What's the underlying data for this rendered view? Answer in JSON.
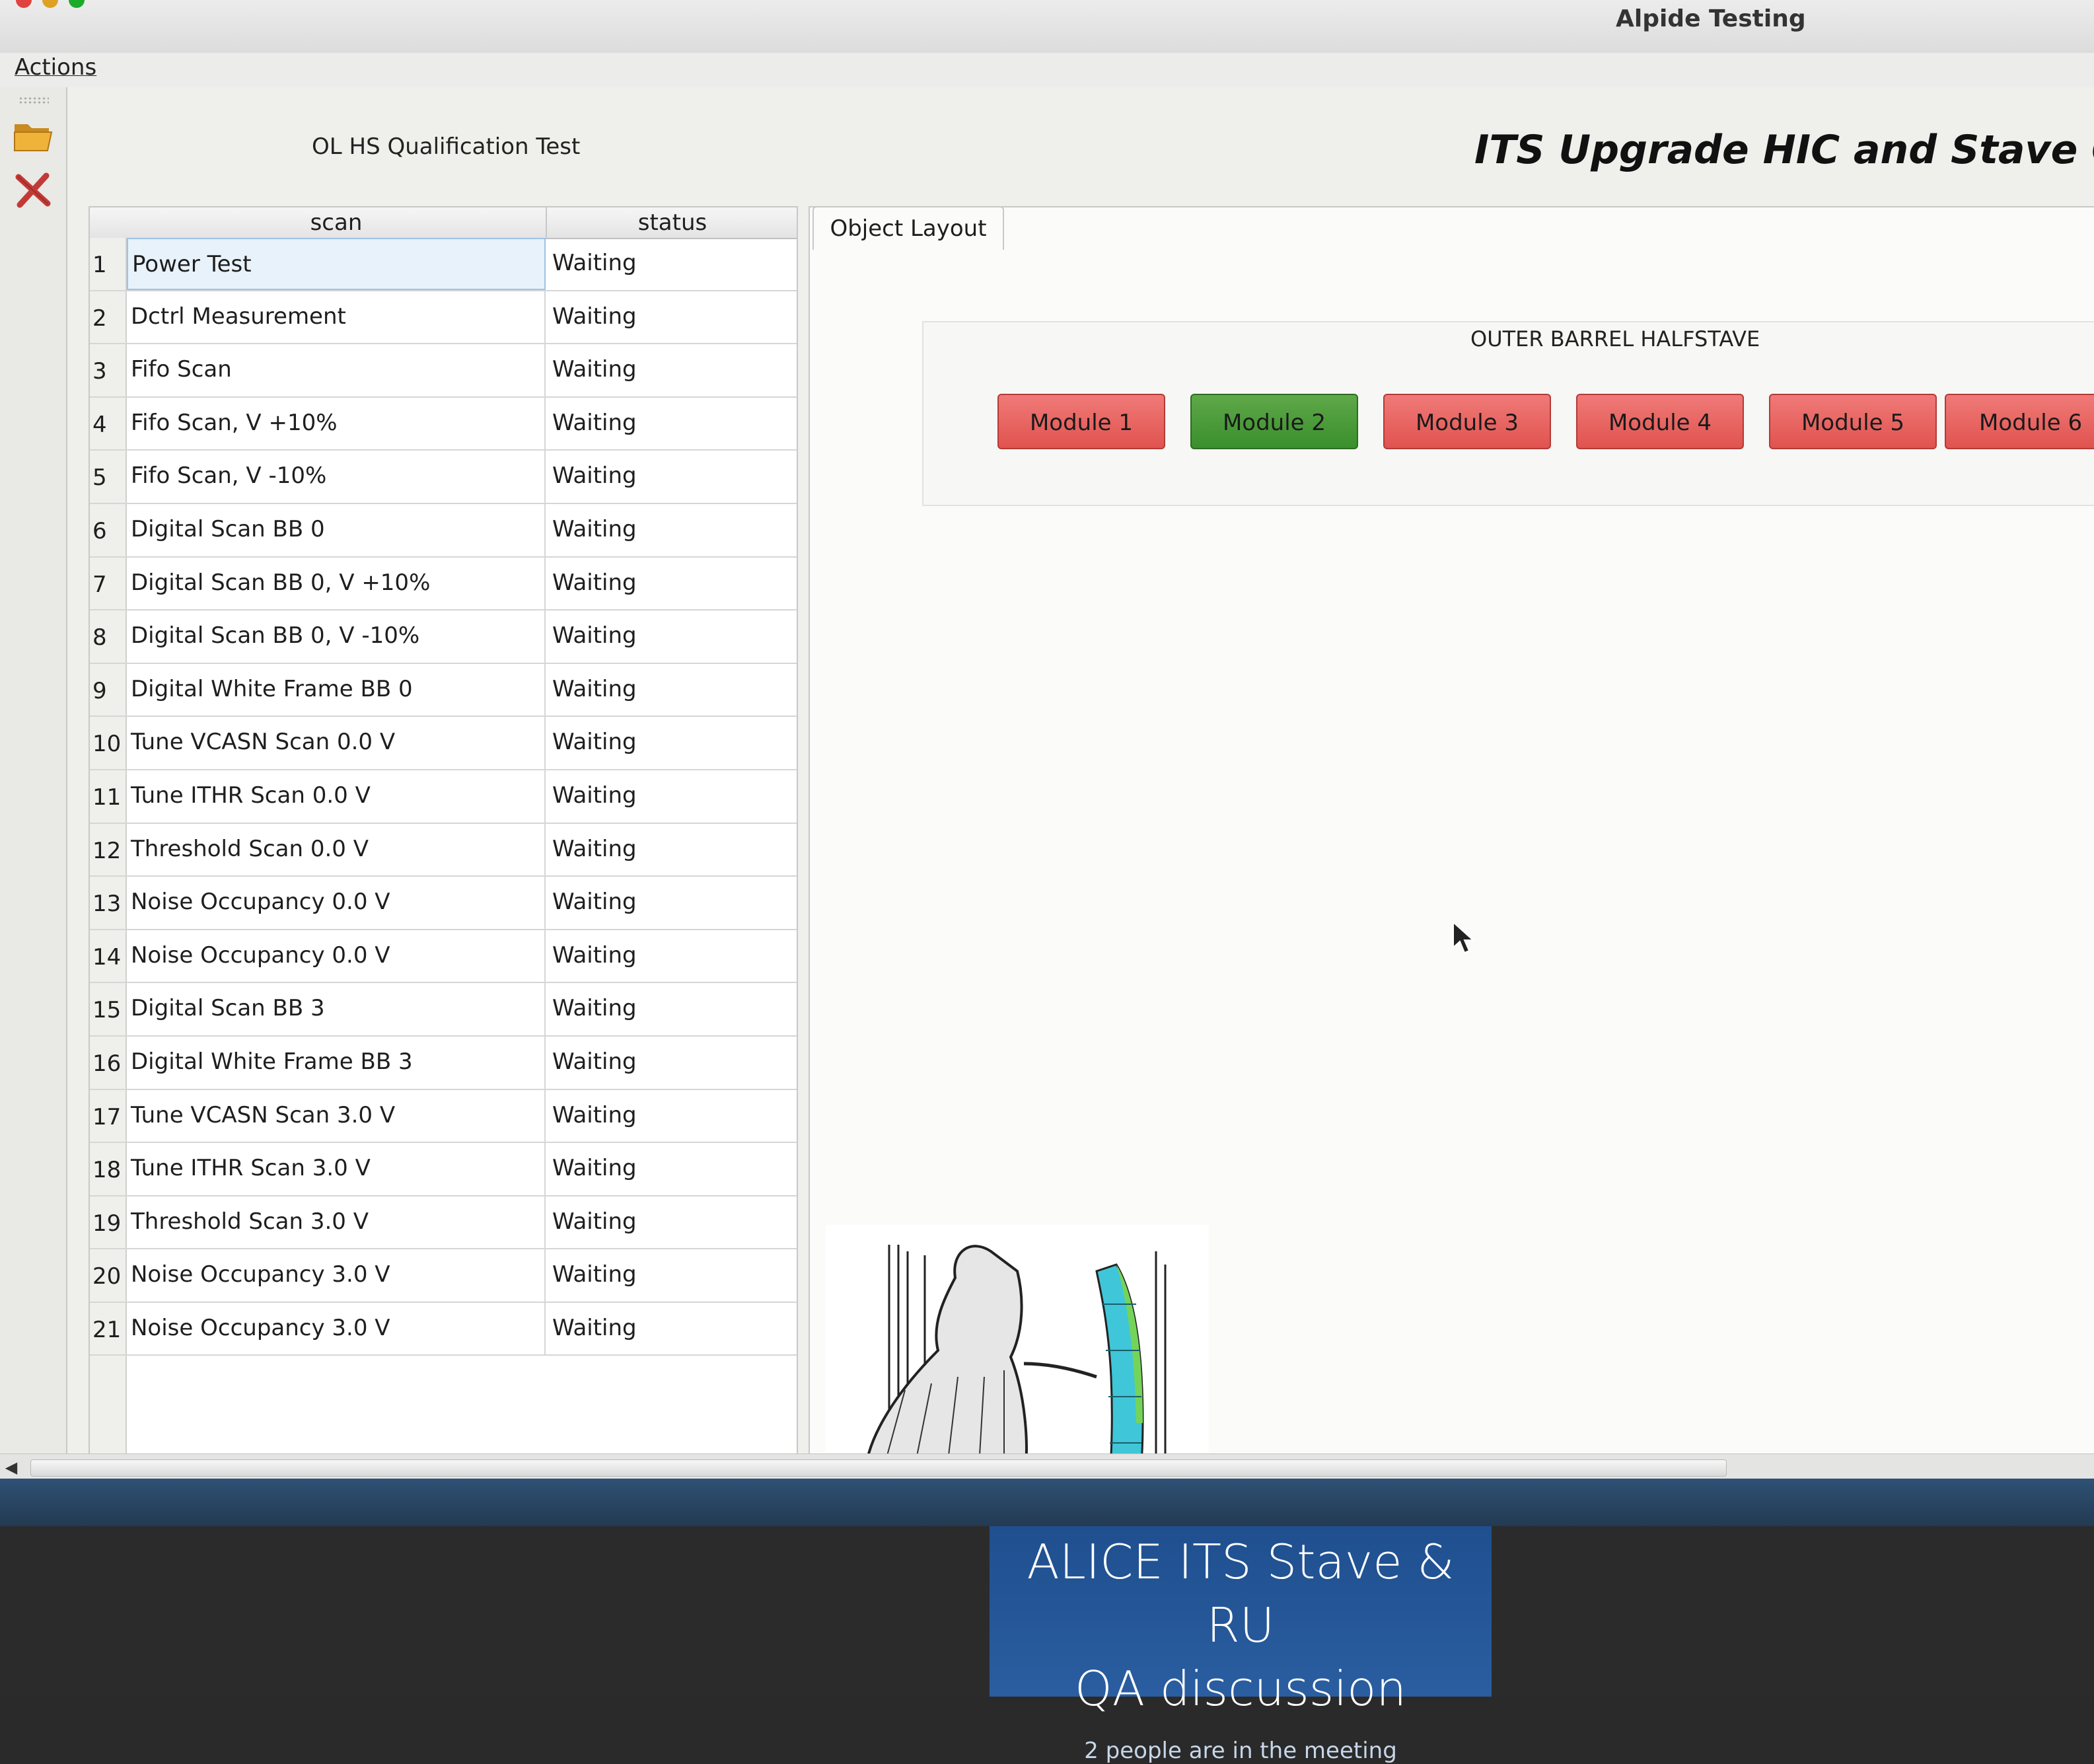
{
  "window": {
    "title": "Alpide Testing"
  },
  "menu": {
    "actions_label": "Actions"
  },
  "toolbar": {
    "open_icon": "folder-open-icon",
    "close_icon": "close-x-icon"
  },
  "header": {
    "test_name": "OL HS Qualification Test",
    "app_title": "ITS Upgrade HIC and Stave Cha"
  },
  "table": {
    "columns": [
      "scan",
      "status"
    ],
    "rows": [
      {
        "n": "1",
        "scan": "Power Test",
        "status": "Waiting"
      },
      {
        "n": "2",
        "scan": "Dctrl Measurement",
        "status": "Waiting"
      },
      {
        "n": "3",
        "scan": "Fifo Scan",
        "status": "Waiting"
      },
      {
        "n": "4",
        "scan": "Fifo Scan, V +10%",
        "status": "Waiting"
      },
      {
        "n": "5",
        "scan": "Fifo Scan, V -10%",
        "status": "Waiting"
      },
      {
        "n": "6",
        "scan": "Digital Scan BB 0",
        "status": "Waiting"
      },
      {
        "n": "7",
        "scan": "Digital Scan BB 0, V +10%",
        "status": "Waiting"
      },
      {
        "n": "8",
        "scan": "Digital Scan BB 0, V -10%",
        "status": "Waiting"
      },
      {
        "n": "9",
        "scan": "Digital White Frame BB 0",
        "status": "Waiting"
      },
      {
        "n": "10",
        "scan": "Tune VCASN Scan 0.0 V",
        "status": "Waiting"
      },
      {
        "n": "11",
        "scan": "Tune ITHR Scan 0.0 V",
        "status": "Waiting"
      },
      {
        "n": "12",
        "scan": "Threshold Scan 0.0 V",
        "status": "Waiting"
      },
      {
        "n": "13",
        "scan": "Noise Occupancy 0.0 V",
        "status": "Waiting"
      },
      {
        "n": "14",
        "scan": "Noise Occupancy 0.0 V",
        "status": "Waiting"
      },
      {
        "n": "15",
        "scan": "Digital Scan BB 3",
        "status": "Waiting"
      },
      {
        "n": "16",
        "scan": "Digital White Frame BB 3",
        "status": "Waiting"
      },
      {
        "n": "17",
        "scan": "Tune VCASN Scan 3.0 V",
        "status": "Waiting"
      },
      {
        "n": "18",
        "scan": "Tune ITHR Scan 3.0 V",
        "status": "Waiting"
      },
      {
        "n": "19",
        "scan": "Threshold Scan 3.0 V",
        "status": "Waiting"
      },
      {
        "n": "20",
        "scan": "Noise Occupancy 3.0 V",
        "status": "Waiting"
      },
      {
        "n": "21",
        "scan": "Noise Occupancy 3.0 V",
        "status": "Waiting"
      }
    ]
  },
  "layout_tab": {
    "label": "Object Layout"
  },
  "halfstave": {
    "title": "OUTER BARREL HALFSTAVE",
    "modules": [
      {
        "label": "Module 1",
        "state": "red"
      },
      {
        "label": "Module 2",
        "state": "green"
      },
      {
        "label": "Module 3",
        "state": "red"
      },
      {
        "label": "Module 4",
        "state": "red"
      },
      {
        "label": "Module 5",
        "state": "red"
      },
      {
        "label": "Module 6",
        "state": "red"
      }
    ]
  },
  "colors": {
    "module_fail": "#e0534f",
    "module_ok": "#3a8f2c",
    "meeting_blue": "#2a5ea0"
  },
  "meeting": {
    "title_line1": "ALICE ITS Stave & RU",
    "title_line2": "QA discussion",
    "participants": "2 people are in the meeting"
  }
}
